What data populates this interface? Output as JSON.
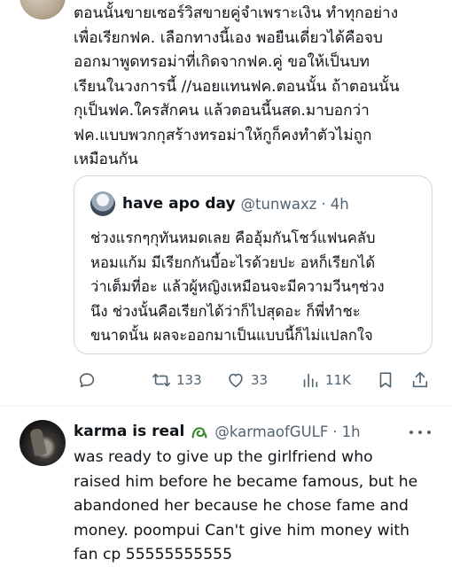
{
  "tweet": {
    "text": "ตอนนั้นขายเซอร์วิสขายคู่จำเพราะเงิน ทำทุกอย่าง\nเพื่อเรียกฟค. เลือกทางนี้เอง พอยืนเดี่ยวได้คือจบ\nออกมาพูดทรอม่าที่เกิดจากฟค.คู่ ขอให้เป็นบท\nเรียนในวงการนี้ //นอยแทนฟค.ตอนนั้น ถ้าตอนนั้น\nกุเป็นฟค.ใครสักคน แล้วตอนนี้นสด.มาบอกว่า\nฟค.แบบพวกกุสร้างทรอม่าให้กูก็คงทำตัวไม่ถูก\nเหมือนกัน"
  },
  "quoted": {
    "name": "have apo day",
    "handle": "@tunwaxz",
    "separator": "·",
    "time": "4h",
    "text": "ช่วงแรกๆกุทันหมดเลย คืออุ้มกันโชว์แฟนคลับ\nหอมแก้ม มีเรียกกันบี้อะไรด้วยปะ อหก็เรียกได้\nว่าเต็มที่อะ แล้วผู้หญิงเหมือนจะมีความวีนๆช่วง\nนึง ช่วงนั้นคือเรียกได้ว่าก็ไปสุดอะ ก็พี่ทำชะ\nขนาดนั้น ผลจะออกมาเป็นแบบนี้ก็ไม่แปลกใจ"
  },
  "actions": {
    "reply_icon": "reply-icon",
    "retweet_icon": "retweet-icon",
    "retweet_count": "133",
    "like_icon": "heart-icon",
    "like_count": "33",
    "views_icon": "views-icon",
    "views_count": "11K",
    "bookmark_icon": "bookmark-icon",
    "share_icon": "share-icon"
  },
  "reply": {
    "name": "karma is real",
    "badge_icon": "green-swirl-emoji",
    "handle": "@karmaofGULF",
    "separator": "·",
    "time": "1h",
    "text": "was ready to give up the girlfriend who\nraised him before he became famous, but he\nabandoned her because he chose fame and\nmoney. poompui Can't give him money with\nfan cp 55555555555"
  },
  "colors": {
    "text": "#0f1419",
    "secondary": "#536471",
    "border": "#cfd9de",
    "badge_green": "#3b8a2a"
  }
}
